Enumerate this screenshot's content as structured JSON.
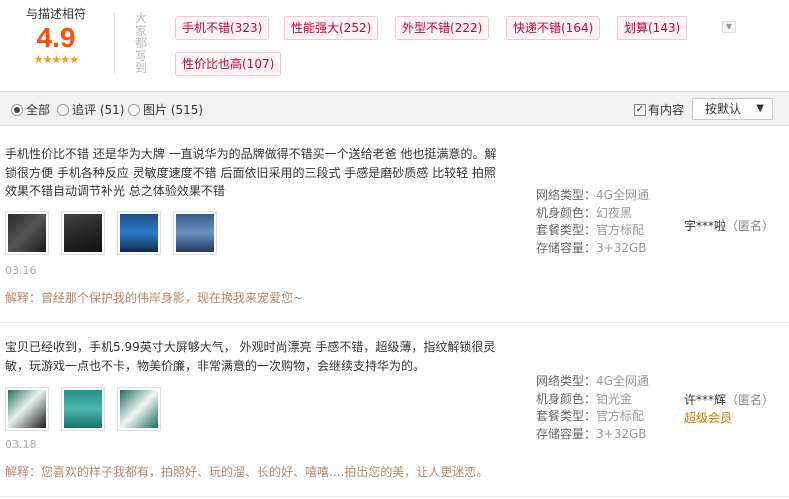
{
  "header": {
    "score_label": "与描述相符",
    "score": "4.9",
    "stars": "★★★★★",
    "tags_label": "大家都写到",
    "tags": [
      "手机不错(323)",
      "性能强大(252)",
      "外型不错(222)",
      "快递不错(164)",
      "划算(143)",
      "性价比也高(107)"
    ],
    "expand_icon": "chevron-down-icon"
  },
  "filter": {
    "options": [
      "全部",
      "追评 (51)",
      "图片 (515)"
    ],
    "selected": "全部",
    "has_content_label": "有内容",
    "has_content_checked": true,
    "sort_label": "按默认"
  },
  "spec_keys": [
    "网络类型：",
    "机身颜色：",
    "套餐类型：",
    "存储容量："
  ],
  "reviews": [
    {
      "text": "手机性价比不错 还是华为大牌 一直说华为的品牌做得不错买一个送给老爸 他也挺满意的。解锁很方便 手机各种反应 灵敏度速度不错 后面依旧采用的三段式 手感是磨砂质感 比较轻 拍照效果不错自动调节补光 总之体验效果不错",
      "thumb_count": 4,
      "date": "03.16",
      "reply": "解释：曾经那个保护我的伟岸身影，现在换我来宠爱您~",
      "specs": [
        "4G全网通",
        "幻夜黑",
        "官方标配",
        "3+32GB"
      ],
      "user": "宇***啦",
      "anon": "（匿名）",
      "badge": ""
    },
    {
      "text": "宝贝已经收到，手机5.99英寸大屏够大气， 外观时尚漂亮 手感不错，超级薄，指纹解锁很灵敏，玩游戏一点也不卡，物美价廉，非常满意的一次购物，会继续支持华为的。",
      "thumb_count": 3,
      "date": "03.18",
      "reply": "解释：您喜欢的样子我都有，拍照好、玩的溜、长的好、嘻嘻....拍出您的美，让人更迷恋。",
      "specs": [
        "4G全网通",
        "铂光金",
        "官方标配",
        "3+32GB"
      ],
      "user": "许***辉",
      "anon": "（匿名）",
      "badge": "超级会员"
    }
  ]
}
